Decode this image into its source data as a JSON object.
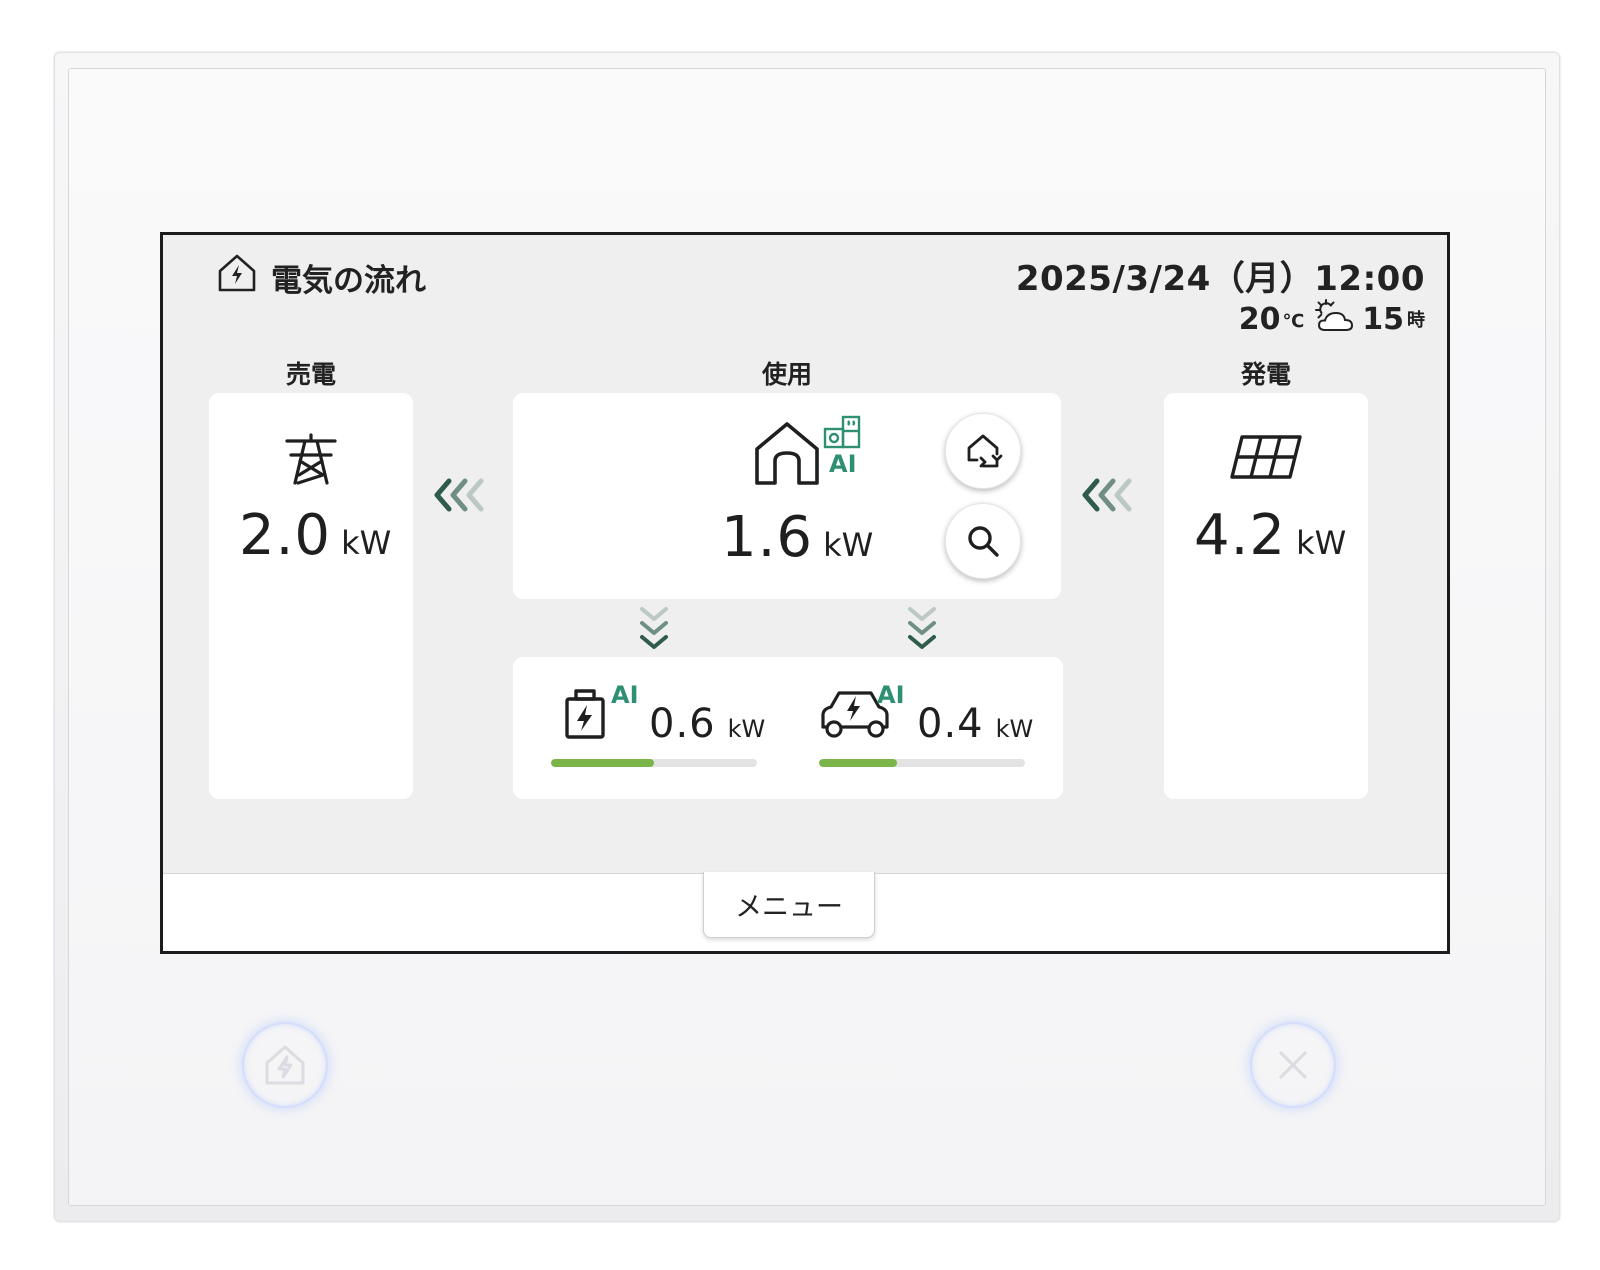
{
  "header": {
    "title": "電気の流れ",
    "datetime": "2025/3/24（月）12:00",
    "weather": {
      "temp": "20",
      "temp_unit": "℃",
      "icon": "sun-cloud-icon",
      "hour": "15",
      "hour_unit": "時"
    }
  },
  "sell": {
    "label": "売電",
    "icon": "power-tower-icon",
    "value": "2.0",
    "unit": "kW"
  },
  "usage": {
    "label": "使用",
    "icon": "house-icon",
    "ai_label": "AI",
    "value": "1.6",
    "unit": "kW"
  },
  "generation": {
    "label": "発電",
    "icon": "solar-panel-icon",
    "value": "4.2",
    "unit": "kW"
  },
  "battery": {
    "icon": "battery-icon",
    "ai_label": "AI",
    "value": "0.6",
    "unit": "kW",
    "level": 0.5
  },
  "ev": {
    "icon": "ev-car-icon",
    "ai_label": "AI",
    "value": "0.4",
    "unit": "kW",
    "level": 0.38
  },
  "menu": {
    "label": "メニュー"
  },
  "colors": {
    "accent_green": "#2f5c4a",
    "ai_green": "#2f8f72",
    "bar_fill": "#7ab54a"
  }
}
